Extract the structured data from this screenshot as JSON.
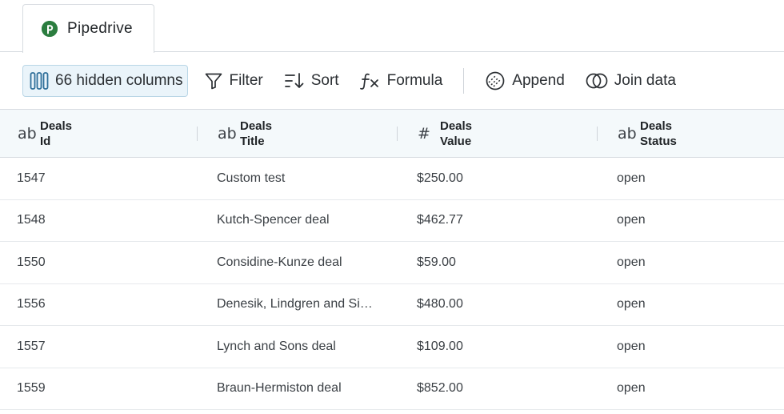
{
  "tab": {
    "label": "Pipedrive",
    "logo_letter": "p",
    "logo_color": "#2b7d3f"
  },
  "toolbar": {
    "hidden_columns": "66 hidden columns",
    "filter": "Filter",
    "sort": "Sort",
    "formula": "Formula",
    "append": "Append",
    "join": "Join data"
  },
  "columns": [
    {
      "type": "ab",
      "line1": "Deals",
      "line2": "Id"
    },
    {
      "type": "#",
      "line1": "Deals",
      "line2": "Title"
    },
    {
      "type": "#",
      "line1": "Deals",
      "line2": "Value"
    },
    {
      "type": "ab",
      "line1": "Deals",
      "line2": "Status"
    }
  ],
  "rows": [
    [
      "1547",
      "Custom test",
      "$250.00",
      "open"
    ],
    [
      "1548",
      "Kutch-Spencer deal",
      "$462.77",
      "open"
    ],
    [
      "1550",
      "Considine-Kunze deal",
      "$59.00",
      "open"
    ],
    [
      "1556",
      "Denesik, Lindgren and Si…",
      "$480.00",
      "open"
    ],
    [
      "1557",
      "Lynch and Sons deal",
      "$109.00",
      "open"
    ],
    [
      "1559",
      "Braun-Hermiston deal",
      "$852.00",
      "open"
    ]
  ]
}
